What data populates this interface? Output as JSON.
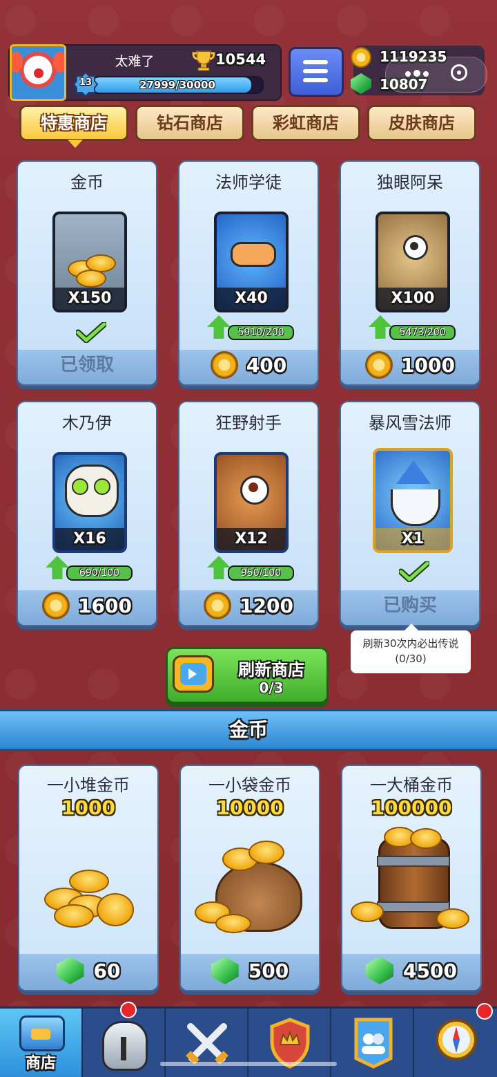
{
  "player": {
    "name": "太难了",
    "trophies": "10544",
    "level": "13",
    "xp_text": "27999/30000",
    "xp_fraction": 0.933
  },
  "currency": {
    "gold": "1119235",
    "gems": "10807"
  },
  "tabs": [
    "特惠商店",
    "钻石商店",
    "彩虹商店",
    "皮肤商店"
  ],
  "active_tab": "特惠商店",
  "deals": [
    {
      "title": "金币",
      "qty": "X150",
      "status": "已领取",
      "icon": "coin-pile-icon"
    },
    {
      "title": "法师学徒",
      "qty": "X40",
      "progress": "5910/200",
      "price": "400",
      "icon": "wizard-apprentice-portrait"
    },
    {
      "title": "独眼阿呆",
      "qty": "X100",
      "progress": "5473/200",
      "price": "1000",
      "icon": "cyclops-portrait"
    },
    {
      "title": "木乃伊",
      "qty": "X16",
      "progress": "690/100",
      "price": "1600",
      "icon": "mummy-portrait"
    },
    {
      "title": "狂野射手",
      "qty": "X12",
      "progress": "950/100",
      "price": "1200",
      "icon": "wild-archer-portrait"
    },
    {
      "title": "暴风雪法师",
      "qty": "X1",
      "status": "已购买",
      "icon": "blizzard-mage-portrait"
    }
  ],
  "tooltip": {
    "line1": "刷新30次内必出传说",
    "line2": "(0/30)"
  },
  "refresh": {
    "label": "刷新商店",
    "count": "0/3"
  },
  "gold_section": {
    "title": "金币",
    "packs": [
      {
        "title": "一小堆金币",
        "amount": "1000",
        "price": "60"
      },
      {
        "title": "一小袋金币",
        "amount": "10000",
        "price": "500"
      },
      {
        "title": "一大桶金币",
        "amount": "100000",
        "price": "4500"
      }
    ]
  },
  "nav": {
    "items": [
      {
        "icon": "shop-chest-icon",
        "label": "商店"
      },
      {
        "icon": "knight-helmet-icon"
      },
      {
        "icon": "crossed-swords-icon"
      },
      {
        "icon": "crown-shield-icon"
      },
      {
        "icon": "team-banner-icon"
      },
      {
        "icon": "compass-icon"
      }
    ]
  },
  "colors": {
    "background": "#8e2f33",
    "accent_gold": "#f9c83b",
    "card_blue": "#c4def7",
    "nav_blue": "#2b4d8c"
  }
}
